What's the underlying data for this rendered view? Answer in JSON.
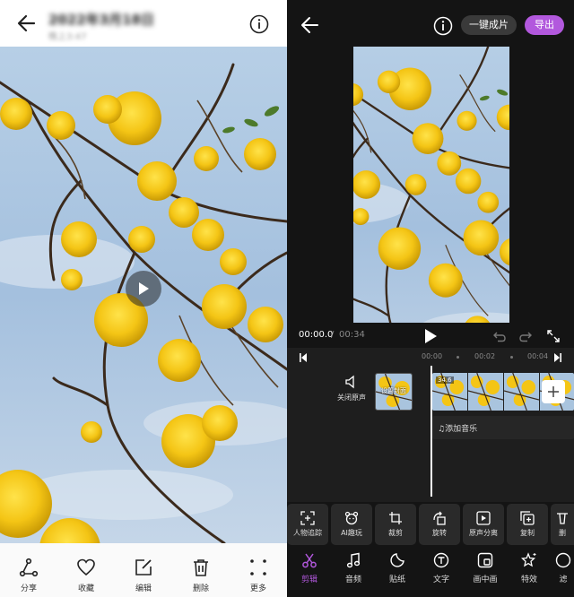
{
  "gallery": {
    "title": "2022年3月18日",
    "subtitle": "晚上3:47",
    "toolbar": [
      {
        "label": "分享",
        "icon": "share-icon"
      },
      {
        "label": "收藏",
        "icon": "heart-icon"
      },
      {
        "label": "编辑",
        "icon": "edit-icon"
      },
      {
        "label": "删除",
        "icon": "trash-icon"
      },
      {
        "label": "更多",
        "icon": "more-icon"
      }
    ]
  },
  "editor": {
    "one_click_label": "一键成片",
    "export_label": "导出",
    "current_time": "00:00.0",
    "time_separator": "/",
    "total_time": "00:34",
    "ruler": [
      "00:00",
      "00:02",
      "00:04"
    ],
    "mute_label": "关闭原声",
    "cover_label": "设置封面",
    "clip_length": "34.6",
    "add_music_label": "♫添加音乐",
    "ops": [
      {
        "label": "人物追踪",
        "icon": "person-track-icon"
      },
      {
        "label": "AI趣玩",
        "icon": "bear-face-icon"
      },
      {
        "label": "裁剪",
        "icon": "crop-icon"
      },
      {
        "label": "旋转",
        "icon": "rotate-icon"
      },
      {
        "label": "原声分离",
        "icon": "audio-separate-icon"
      },
      {
        "label": "复制",
        "icon": "copy-icon"
      },
      {
        "label": "删",
        "icon": "delete-icon"
      }
    ],
    "tabs": [
      {
        "label": "剪辑",
        "icon": "scissors-icon",
        "active": true
      },
      {
        "label": "音频",
        "icon": "music-note-icon"
      },
      {
        "label": "贴纸",
        "icon": "sticker-icon"
      },
      {
        "label": "文字",
        "icon": "text-icon"
      },
      {
        "label": "画中画",
        "icon": "pip-icon"
      },
      {
        "label": "特效",
        "icon": "effects-star-icon"
      },
      {
        "label": "滤",
        "icon": "filter-icon"
      }
    ]
  },
  "colors": {
    "accent": "#b258dd",
    "editor_bg": "#141414",
    "sky": "#a9c6e3",
    "flower": "#f2c614"
  }
}
